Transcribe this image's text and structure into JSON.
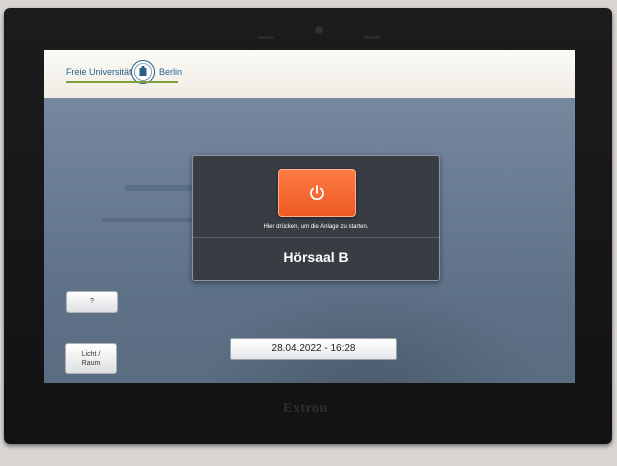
{
  "header": {
    "logo_left": "Freie Universität",
    "logo_right": "Berlin"
  },
  "dialog": {
    "hint": "Hier drücken, um die Anlage zu starten.",
    "room": "Hörsaal B"
  },
  "buttons": {
    "help_label": "?",
    "light_label": "Licht /\nRaum"
  },
  "status": {
    "datetime": "28.04.2022  -  16:28"
  },
  "device": {
    "brand": "Extron"
  },
  "icons": {
    "power": "power-icon",
    "logo": "university-seal-icon"
  },
  "colors": {
    "power_button": "#ec5a22",
    "header_bg": "#f5f3ee",
    "screen_bg": "#6d8097",
    "dialog_bg": "#383d44"
  }
}
